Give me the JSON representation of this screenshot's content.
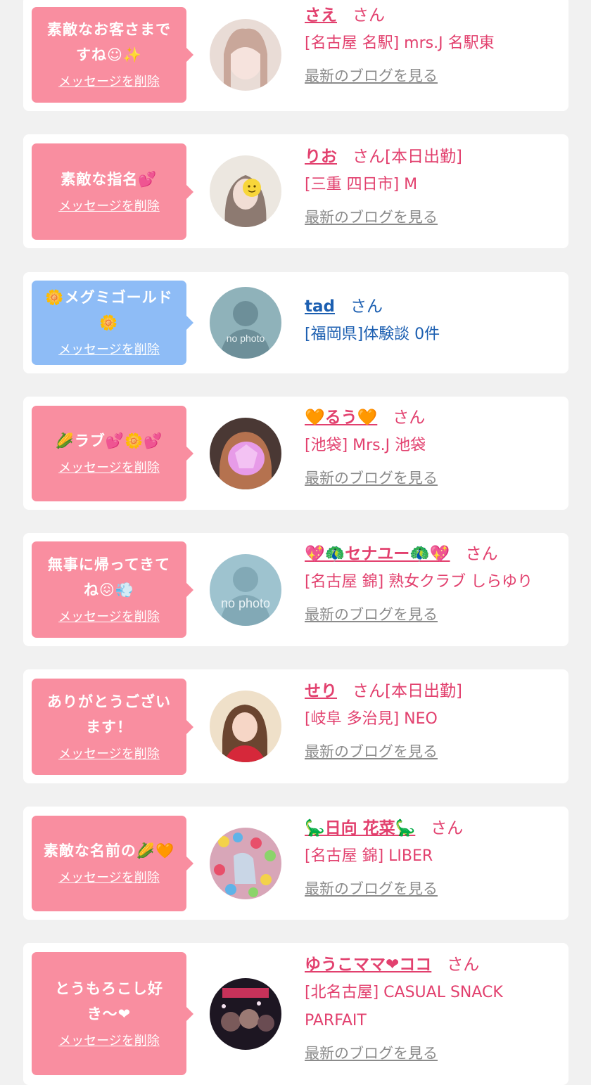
{
  "colors": {
    "pink_bubble": "#f98ea0",
    "blue_bubble": "#8ebcf6",
    "pink_text": "#e2406e",
    "blue_text": "#1c5fb1",
    "blog_link": "#8b8b8b",
    "background": "#f1f1f1"
  },
  "cards": [
    {
      "message_lines": [
        "素敵なお客さまで",
        "すね☺✨"
      ],
      "delete_label": "メッセージを削除",
      "name": "さえ",
      "suffix": "さん",
      "shop_lines": [
        "[名古屋 名駅] mrs.J 名駅東"
      ],
      "blog_label": "最新のブログを見る",
      "avatar": "photo-avatar"
    },
    {
      "message_lines": [
        "素敵な指名💕"
      ],
      "delete_label": "メッセージを削除",
      "name": "りお",
      "suffix": "さん[本日出勤]",
      "shop_lines": [
        "[三重 四日市] M"
      ],
      "blog_label": "最新のブログを見る",
      "avatar": "photo-avatar"
    },
    {
      "message_lines": [
        "🌼メグミゴールド",
        "🌼"
      ],
      "delete_label": "メッセージを削除",
      "name": "tad",
      "suffix": "さん",
      "shop_lines": [
        "[福岡県]体験談 0件"
      ],
      "blog_label": "",
      "avatar": "no-photo-avatar",
      "no_photo_text": "no photo"
    },
    {
      "message_lines": [
        "🌽ラブ💕🌼💕"
      ],
      "delete_label": "メッセージを削除",
      "name": "🧡るう🧡",
      "suffix": "さん",
      "shop_lines": [
        "[池袋] Mrs.J 池袋"
      ],
      "blog_label": "最新のブログを見る",
      "avatar": "photo-avatar"
    },
    {
      "message_lines": [
        "無事に帰ってきて",
        "ね😖💨"
      ],
      "delete_label": "メッセージを削除",
      "name": "💖🦚セナユー🦚💖",
      "suffix": "さん",
      "shop_lines": [
        "[名古屋 錦] 熟女クラブ しらゆり"
      ],
      "blog_label": "最新のブログを見る",
      "avatar": "no-photo-avatar",
      "no_photo_text": "no photo"
    },
    {
      "message_lines": [
        "ありがとうござい",
        "ます！"
      ],
      "delete_label": "メッセージを削除",
      "name": "せり",
      "suffix": "さん[本日出勤]",
      "shop_lines": [
        "[岐阜 多治見] NEO"
      ],
      "blog_label": "最新のブログを見る",
      "avatar": "photo-avatar"
    },
    {
      "message_lines": [
        "素敵な名前の🌽🧡"
      ],
      "delete_label": "メッセージを削除",
      "name": "🦕日向 花菜🦕",
      "suffix": "さん",
      "shop_lines": [
        "[名古屋 錦] LIBER"
      ],
      "blog_label": "最新のブログを見る",
      "avatar": "photo-avatar"
    },
    {
      "message_lines": [
        "とうもろこし好",
        "き〜❤"
      ],
      "delete_label": "メッセージを削除",
      "name": "ゆうこママ❤ココ",
      "suffix": "さん",
      "shop_lines": [
        "[北名古屋] CASUAL SNACK",
        "PARFAIT"
      ],
      "blog_label": "最新のブログを見る",
      "avatar": "photo-avatar"
    }
  ]
}
